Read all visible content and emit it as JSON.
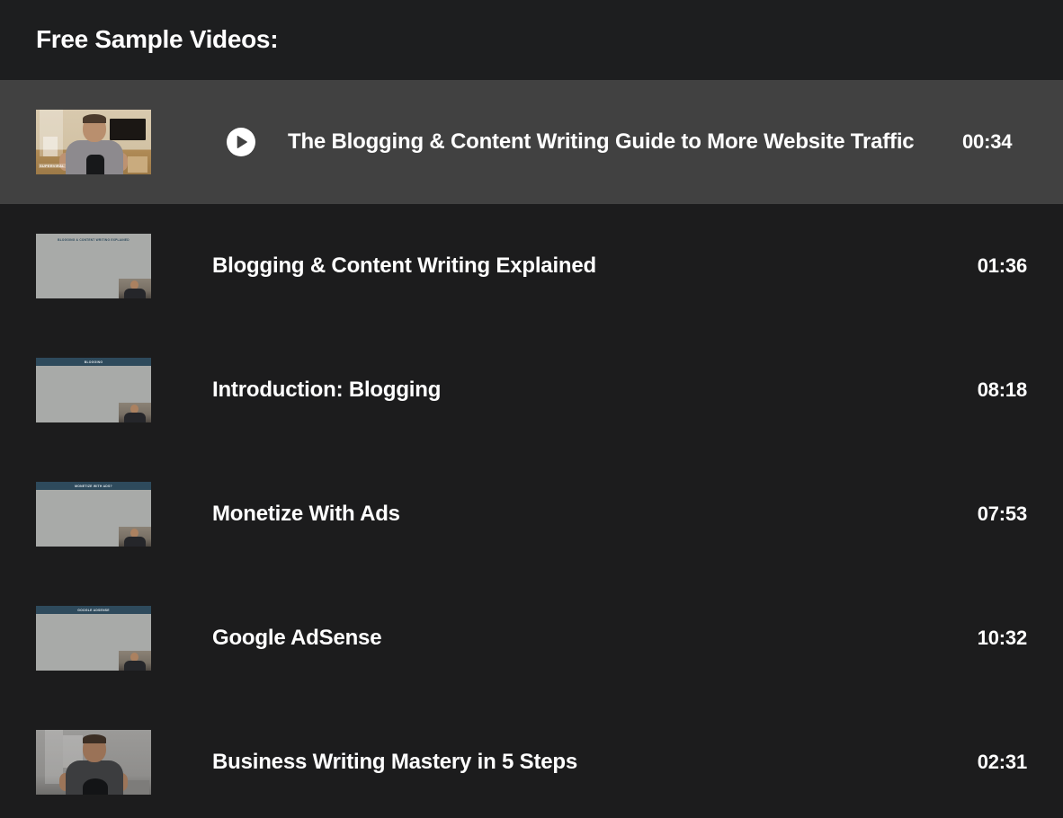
{
  "header": {
    "title": "Free Sample Videos:"
  },
  "colors": {
    "page_background": "#1c1c1d",
    "header_background": "#1d1e1f",
    "active_row_background": "#414141",
    "text": "#ffffff"
  },
  "videos": [
    {
      "title": "The Blogging & Content Writing Guide to More Website Traffic",
      "duration": "00:34",
      "active": true,
      "thumbnail_type": "talking-head",
      "thumbnail_watermark": "SUPERVIRAL"
    },
    {
      "title": "Blogging & Content Writing Explained",
      "duration": "01:36",
      "active": false,
      "thumbnail_type": "slide",
      "thumbnail_slide_text": "BLOGGING & CONTENT WRITING EXPLAINED"
    },
    {
      "title": "Introduction: Blogging",
      "duration": "08:18",
      "active": false,
      "thumbnail_type": "slide",
      "thumbnail_slide_text": "BLOGGING"
    },
    {
      "title": "Monetize With Ads",
      "duration": "07:53",
      "active": false,
      "thumbnail_type": "slide",
      "thumbnail_slide_text": "MONETIZE WITH ADS?"
    },
    {
      "title": "Google AdSense",
      "duration": "10:32",
      "active": false,
      "thumbnail_type": "slide",
      "thumbnail_slide_text": "GOOGLE ADSENSE"
    },
    {
      "title": "Business Writing Mastery in 5 Steps",
      "duration": "02:31",
      "active": false,
      "thumbnail_type": "talking-head-dim"
    }
  ],
  "icons": {
    "play": "play-icon"
  }
}
